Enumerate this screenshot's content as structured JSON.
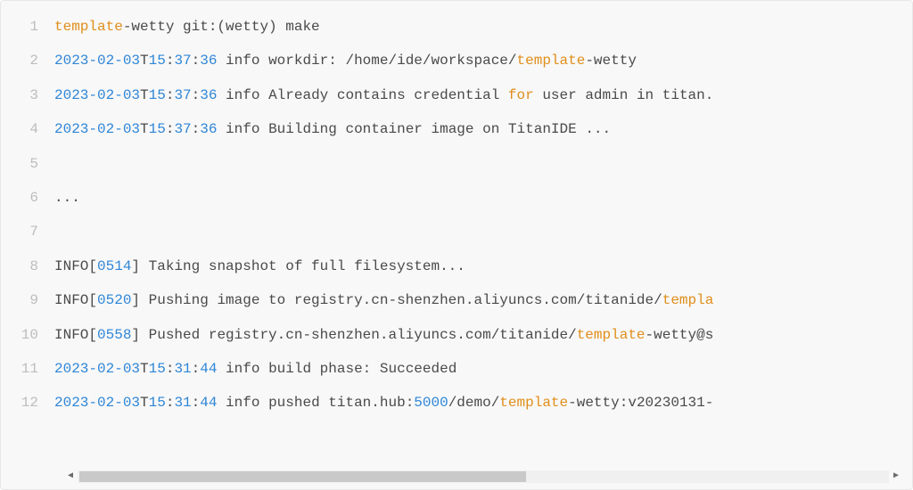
{
  "scrollbar": {
    "arrow_left": "◀",
    "arrow_right": "▶"
  },
  "lines": [
    {
      "n": "1",
      "tokens": [
        {
          "t": "template",
          "c": "tok-kw"
        },
        {
          "t": "-wetty git:(wetty) make"
        }
      ]
    },
    {
      "n": "2",
      "tokens": [
        {
          "t": "2023-02-03",
          "c": "tok-date"
        },
        {
          "t": "T"
        },
        {
          "t": "15",
          "c": "tok-time"
        },
        {
          "t": ":"
        },
        {
          "t": "37",
          "c": "tok-time"
        },
        {
          "t": ":"
        },
        {
          "t": "36",
          "c": "tok-time"
        },
        {
          "t": " info workdir: /home/ide/workspace/"
        },
        {
          "t": "template",
          "c": "tok-kw"
        },
        {
          "t": "-wetty"
        }
      ]
    },
    {
      "n": "3",
      "tokens": [
        {
          "t": "2023-02-03",
          "c": "tok-date"
        },
        {
          "t": "T"
        },
        {
          "t": "15",
          "c": "tok-time"
        },
        {
          "t": ":"
        },
        {
          "t": "37",
          "c": "tok-time"
        },
        {
          "t": ":"
        },
        {
          "t": "36",
          "c": "tok-time"
        },
        {
          "t": " info Already contains credential "
        },
        {
          "t": "for",
          "c": "tok-kw"
        },
        {
          "t": " user admin in titan."
        }
      ]
    },
    {
      "n": "4",
      "tokens": [
        {
          "t": "2023-02-03",
          "c": "tok-date"
        },
        {
          "t": "T"
        },
        {
          "t": "15",
          "c": "tok-time"
        },
        {
          "t": ":"
        },
        {
          "t": "37",
          "c": "tok-time"
        },
        {
          "t": ":"
        },
        {
          "t": "36",
          "c": "tok-time"
        },
        {
          "t": " info Building container image on TitanIDE ..."
        }
      ]
    },
    {
      "n": "5",
      "tokens": [
        {
          "t": ""
        }
      ]
    },
    {
      "n": "6",
      "tokens": [
        {
          "t": "..."
        }
      ]
    },
    {
      "n": "7",
      "tokens": [
        {
          "t": ""
        }
      ]
    },
    {
      "n": "8",
      "tokens": [
        {
          "t": "INFO["
        },
        {
          "t": "0514",
          "c": "tok-num"
        },
        {
          "t": "] Taking snapshot of full filesystem..."
        }
      ]
    },
    {
      "n": "9",
      "tokens": [
        {
          "t": "INFO["
        },
        {
          "t": "0520",
          "c": "tok-num"
        },
        {
          "t": "] Pushing image to registry.cn-shenzhen.aliyuncs.com/titanide/"
        },
        {
          "t": "templa",
          "c": "tok-kw"
        }
      ]
    },
    {
      "n": "10",
      "tokens": [
        {
          "t": "INFO["
        },
        {
          "t": "0558",
          "c": "tok-num"
        },
        {
          "t": "] Pushed registry.cn-shenzhen.aliyuncs.com/titanide/"
        },
        {
          "t": "template",
          "c": "tok-kw"
        },
        {
          "t": "-wetty@s"
        }
      ]
    },
    {
      "n": "11",
      "tokens": [
        {
          "t": "2023-02-03",
          "c": "tok-date"
        },
        {
          "t": "T"
        },
        {
          "t": "15",
          "c": "tok-time"
        },
        {
          "t": ":"
        },
        {
          "t": "31",
          "c": "tok-time"
        },
        {
          "t": ":"
        },
        {
          "t": "44",
          "c": "tok-time"
        },
        {
          "t": " info build phase: Succeeded"
        }
      ]
    },
    {
      "n": "12",
      "tokens": [
        {
          "t": "2023-02-03",
          "c": "tok-date"
        },
        {
          "t": "T"
        },
        {
          "t": "15",
          "c": "tok-time"
        },
        {
          "t": ":"
        },
        {
          "t": "31",
          "c": "tok-time"
        },
        {
          "t": ":"
        },
        {
          "t": "44",
          "c": "tok-time"
        },
        {
          "t": " info pushed titan.hub:"
        },
        {
          "t": "5000",
          "c": "tok-num"
        },
        {
          "t": "/demo/"
        },
        {
          "t": "template",
          "c": "tok-kw"
        },
        {
          "t": "-wetty:v20230131-"
        }
      ]
    }
  ]
}
